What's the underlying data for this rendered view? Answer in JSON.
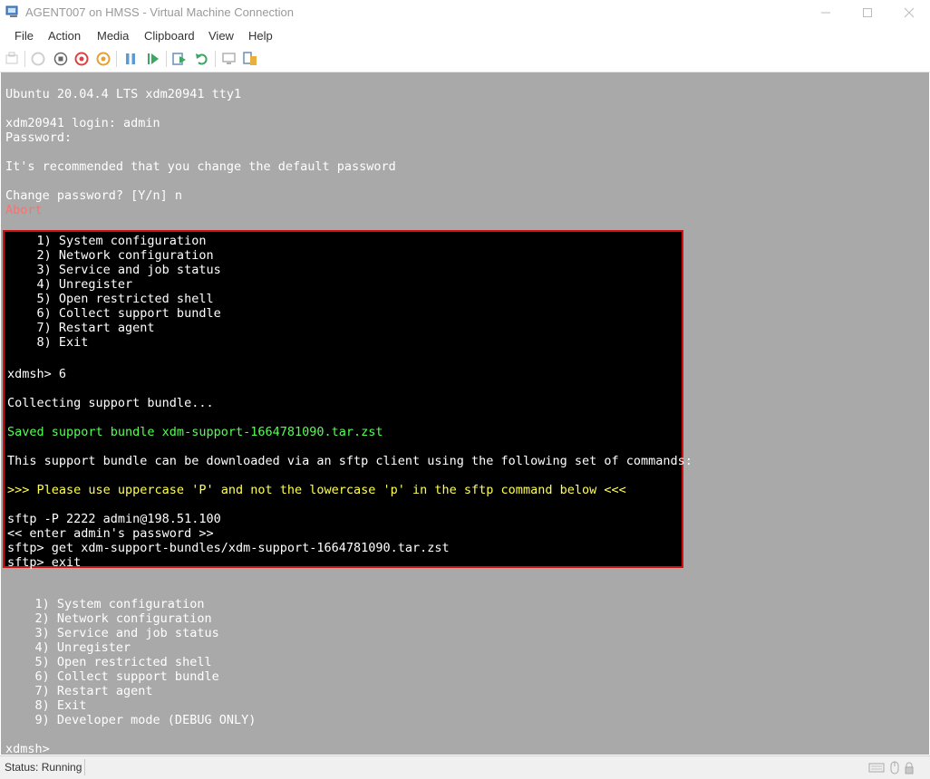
{
  "window": {
    "title": "AGENT007 on HMSS - Virtual Machine Connection"
  },
  "menu": [
    "File",
    "Action",
    "Media",
    "Clipboard",
    "View",
    "Help"
  ],
  "console": {
    "header_lines": [
      "Ubuntu 20.04.4 LTS xdm20941 tty1",
      "",
      "xdm20941 login: admin",
      "Password:",
      "",
      "It's recommended that you change the default password",
      "",
      "Change password? [Y/n] n"
    ],
    "abort_text": "Abort",
    "menu_options": [
      "    1) System configuration",
      "    2) Network configuration",
      "    3) Service and job status",
      "    4) Unregister",
      "    5) Open restricted shell",
      "    6) Collect support bundle",
      "    7) Restart agent",
      "    8) Exit"
    ],
    "prompt_input": "xdmsh> 6",
    "collecting": "Collecting support bundle...",
    "saved": "Saved support bundle xdm-support-1664781090.tar.zst",
    "download_info": "This support bundle can be downloaded via an sftp client using the following set of commands:",
    "warning": ">>> Please use uppercase 'P' and not the lowercase 'p' in the sftp command below <<<",
    "sftp_lines": [
      "sftp -P 2222 admin@198.51.100",
      "<< enter admin's password >>",
      "sftp> get xdm-support-bundles/xdm-support-1664781090.tar.zst",
      "sftp> exit"
    ],
    "menu2_options": [
      "    1) System configuration",
      "    2) Network configuration",
      "    3) Service and job status",
      "    4) Unregister",
      "    5) Open restricted shell",
      "    6) Collect support bundle",
      "    7) Restart agent",
      "    8) Exit",
      "    9) Developer mode (DEBUG ONLY)"
    ],
    "final_prompt": "xdmsh>"
  },
  "status": {
    "text": "Status: Running"
  },
  "colors": {
    "console_bg": "#a9a9a9",
    "highlight_border": "#d01010",
    "green_text": "#54ff54",
    "yellow_text": "#ffff54",
    "abort_text": "#ff7070"
  }
}
